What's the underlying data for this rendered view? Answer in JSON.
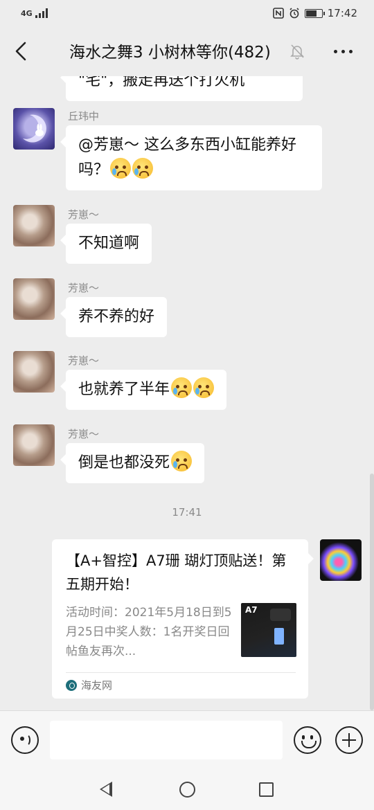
{
  "status_bar": {
    "network": "4G",
    "time": "17:42",
    "battery_level": 0.7
  },
  "header": {
    "title": "海水之舞3 小树林等你(482)"
  },
  "messages": {
    "partial_top": "\"宅\"，搬走再送个打火机",
    "m1": {
      "sender": "丘玮中",
      "text": "@芳崽～ 这么多东西小缸能养好吗？"
    },
    "m2": {
      "sender": "芳崽～",
      "text": "不知道啊"
    },
    "m3": {
      "sender": "芳崽～",
      "text": "养不养的好"
    },
    "m4": {
      "sender": "芳崽～",
      "text": "也就养了半年"
    },
    "m5": {
      "sender": "芳崽～",
      "text": "倒是也都没死"
    }
  },
  "divider_time": "17:41",
  "link_card": {
    "title": "【A+智控】A7珊 瑚灯顶贴送！第五期开始！",
    "description": "活动时间：2021年5月18日到5月25日中奖人数：1名开奖日回帖鱼友再次...",
    "thumbnail_label": "A7",
    "source": "海友网"
  },
  "icons": {
    "back": "back-chevron-icon",
    "mute": "mute-bell-icon",
    "more": "more-dots-icon",
    "voice": "voice-icon",
    "emoji": "emoji-icon",
    "plus": "plus-icon"
  }
}
